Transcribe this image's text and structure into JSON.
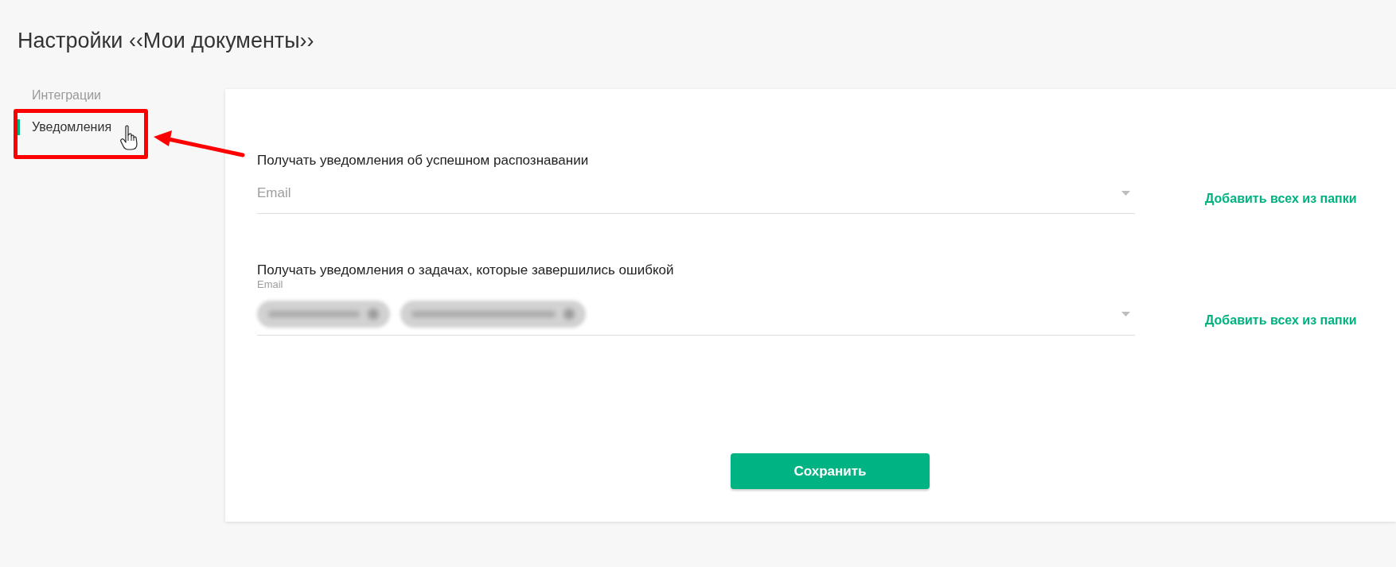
{
  "page": {
    "title": "Настройки ‹‹Мои документы››"
  },
  "sidebar": {
    "items": [
      {
        "label": "Интеграции",
        "selected": false
      },
      {
        "label": "Уведомления",
        "selected": true
      }
    ]
  },
  "settings": {
    "fields": [
      {
        "label": "Получать уведомления об успешном распознавании",
        "placeholder": "Email",
        "action": "Добавить всех из папки"
      },
      {
        "label": "Получать уведомления о задачах, которые завершились ошибкой",
        "field_label": "Email",
        "chips": [
          {
            "kind": "blurred"
          },
          {
            "kind": "blurred"
          }
        ],
        "action": "Добавить всех из папки"
      }
    ],
    "save_button": "Сохранить"
  },
  "annotations": [
    {
      "kind": "frame"
    },
    {
      "kind": "arrow"
    },
    {
      "kind": "cursor"
    }
  ]
}
